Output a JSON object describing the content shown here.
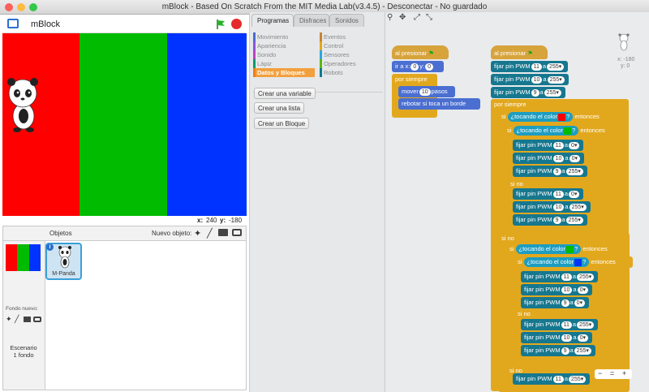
{
  "window": {
    "title": "mBlock - Based On Scratch From the MIT Media Lab(v3.4.5) - Desconectar - No guardado"
  },
  "stage": {
    "name": "mBlock",
    "coords": {
      "x_label": "x:",
      "x": "240",
      "y_label": "y:",
      "y": "-180"
    },
    "bands": [
      "#ff0000",
      "#00bb00",
      "#0033ff"
    ]
  },
  "sprites": {
    "header": "Objetos",
    "new_label": "Nuevo objeto:",
    "stage_label": "Escenario",
    "stage_sub": "1 fondo",
    "new_bg_label": "Fondo nuevo:",
    "sprite_name": "M-Panda",
    "sprite_badge": "i"
  },
  "palette": {
    "tabs": [
      "Programas",
      "Disfraces",
      "Sonidos"
    ],
    "categories_left": [
      {
        "label": "Movimiento",
        "color": "#4a6cd4"
      },
      {
        "label": "Apariencia",
        "color": "#8a55d7"
      },
      {
        "label": "Sonido",
        "color": "#bb42c3"
      },
      {
        "label": "Lápiz",
        "color": "#0e9a6c"
      },
      {
        "label": "Datos y Bloques",
        "color": "#ee7d16"
      }
    ],
    "categories_right": [
      {
        "label": "Eventos",
        "color": "#c88330"
      },
      {
        "label": "Control",
        "color": "#e1a91a"
      },
      {
        "label": "Sensores",
        "color": "#2ca5e2"
      },
      {
        "label": "Operadores",
        "color": "#5cb712"
      },
      {
        "label": "Robots",
        "color": "#0d7a8e"
      }
    ],
    "buttons": [
      "Crear una variable",
      "Crear una lista",
      "Crear un Bloque"
    ]
  },
  "scripts": {
    "coords": {
      "x": "x: -180",
      "y": "y: 0"
    },
    "s1": {
      "hat": "al presionar",
      "goto": "ir a x:",
      "gx": "0",
      "gy_label": "y:",
      "gy": "0",
      "forever": "por siempre",
      "move": "mover",
      "move_n": "10",
      "move_unit": "pasos",
      "bounce": "rebotar si toca un borde"
    },
    "s2": {
      "hat": "al presionar",
      "pwm": "fijar pin PWM",
      "a": "a",
      "if": "si",
      "then": "entonces",
      "else": "si no",
      "forever": "por siempre",
      "touch": "¿tocando el color",
      "q": "?",
      "rows": [
        [
          "11",
          "255"
        ],
        [
          "10",
          "255"
        ],
        [
          "9",
          "255"
        ]
      ],
      "g1": [
        [
          "11",
          "0"
        ],
        [
          "10",
          "0"
        ],
        [
          "9",
          "255"
        ]
      ],
      "g2": [
        [
          "11",
          "0"
        ],
        [
          "10",
          "255"
        ],
        [
          "9",
          "255"
        ]
      ],
      "b1": [
        [
          "11",
          "255"
        ],
        [
          "10",
          "0"
        ],
        [
          "9",
          "0"
        ]
      ],
      "b2": [
        [
          "11",
          "255"
        ],
        [
          "10",
          "0"
        ],
        [
          "9",
          "255"
        ]
      ],
      "last": [
        "11",
        "255"
      ]
    },
    "zoom": {
      "minus": "−",
      "eq": "=",
      "plus": "+"
    }
  }
}
